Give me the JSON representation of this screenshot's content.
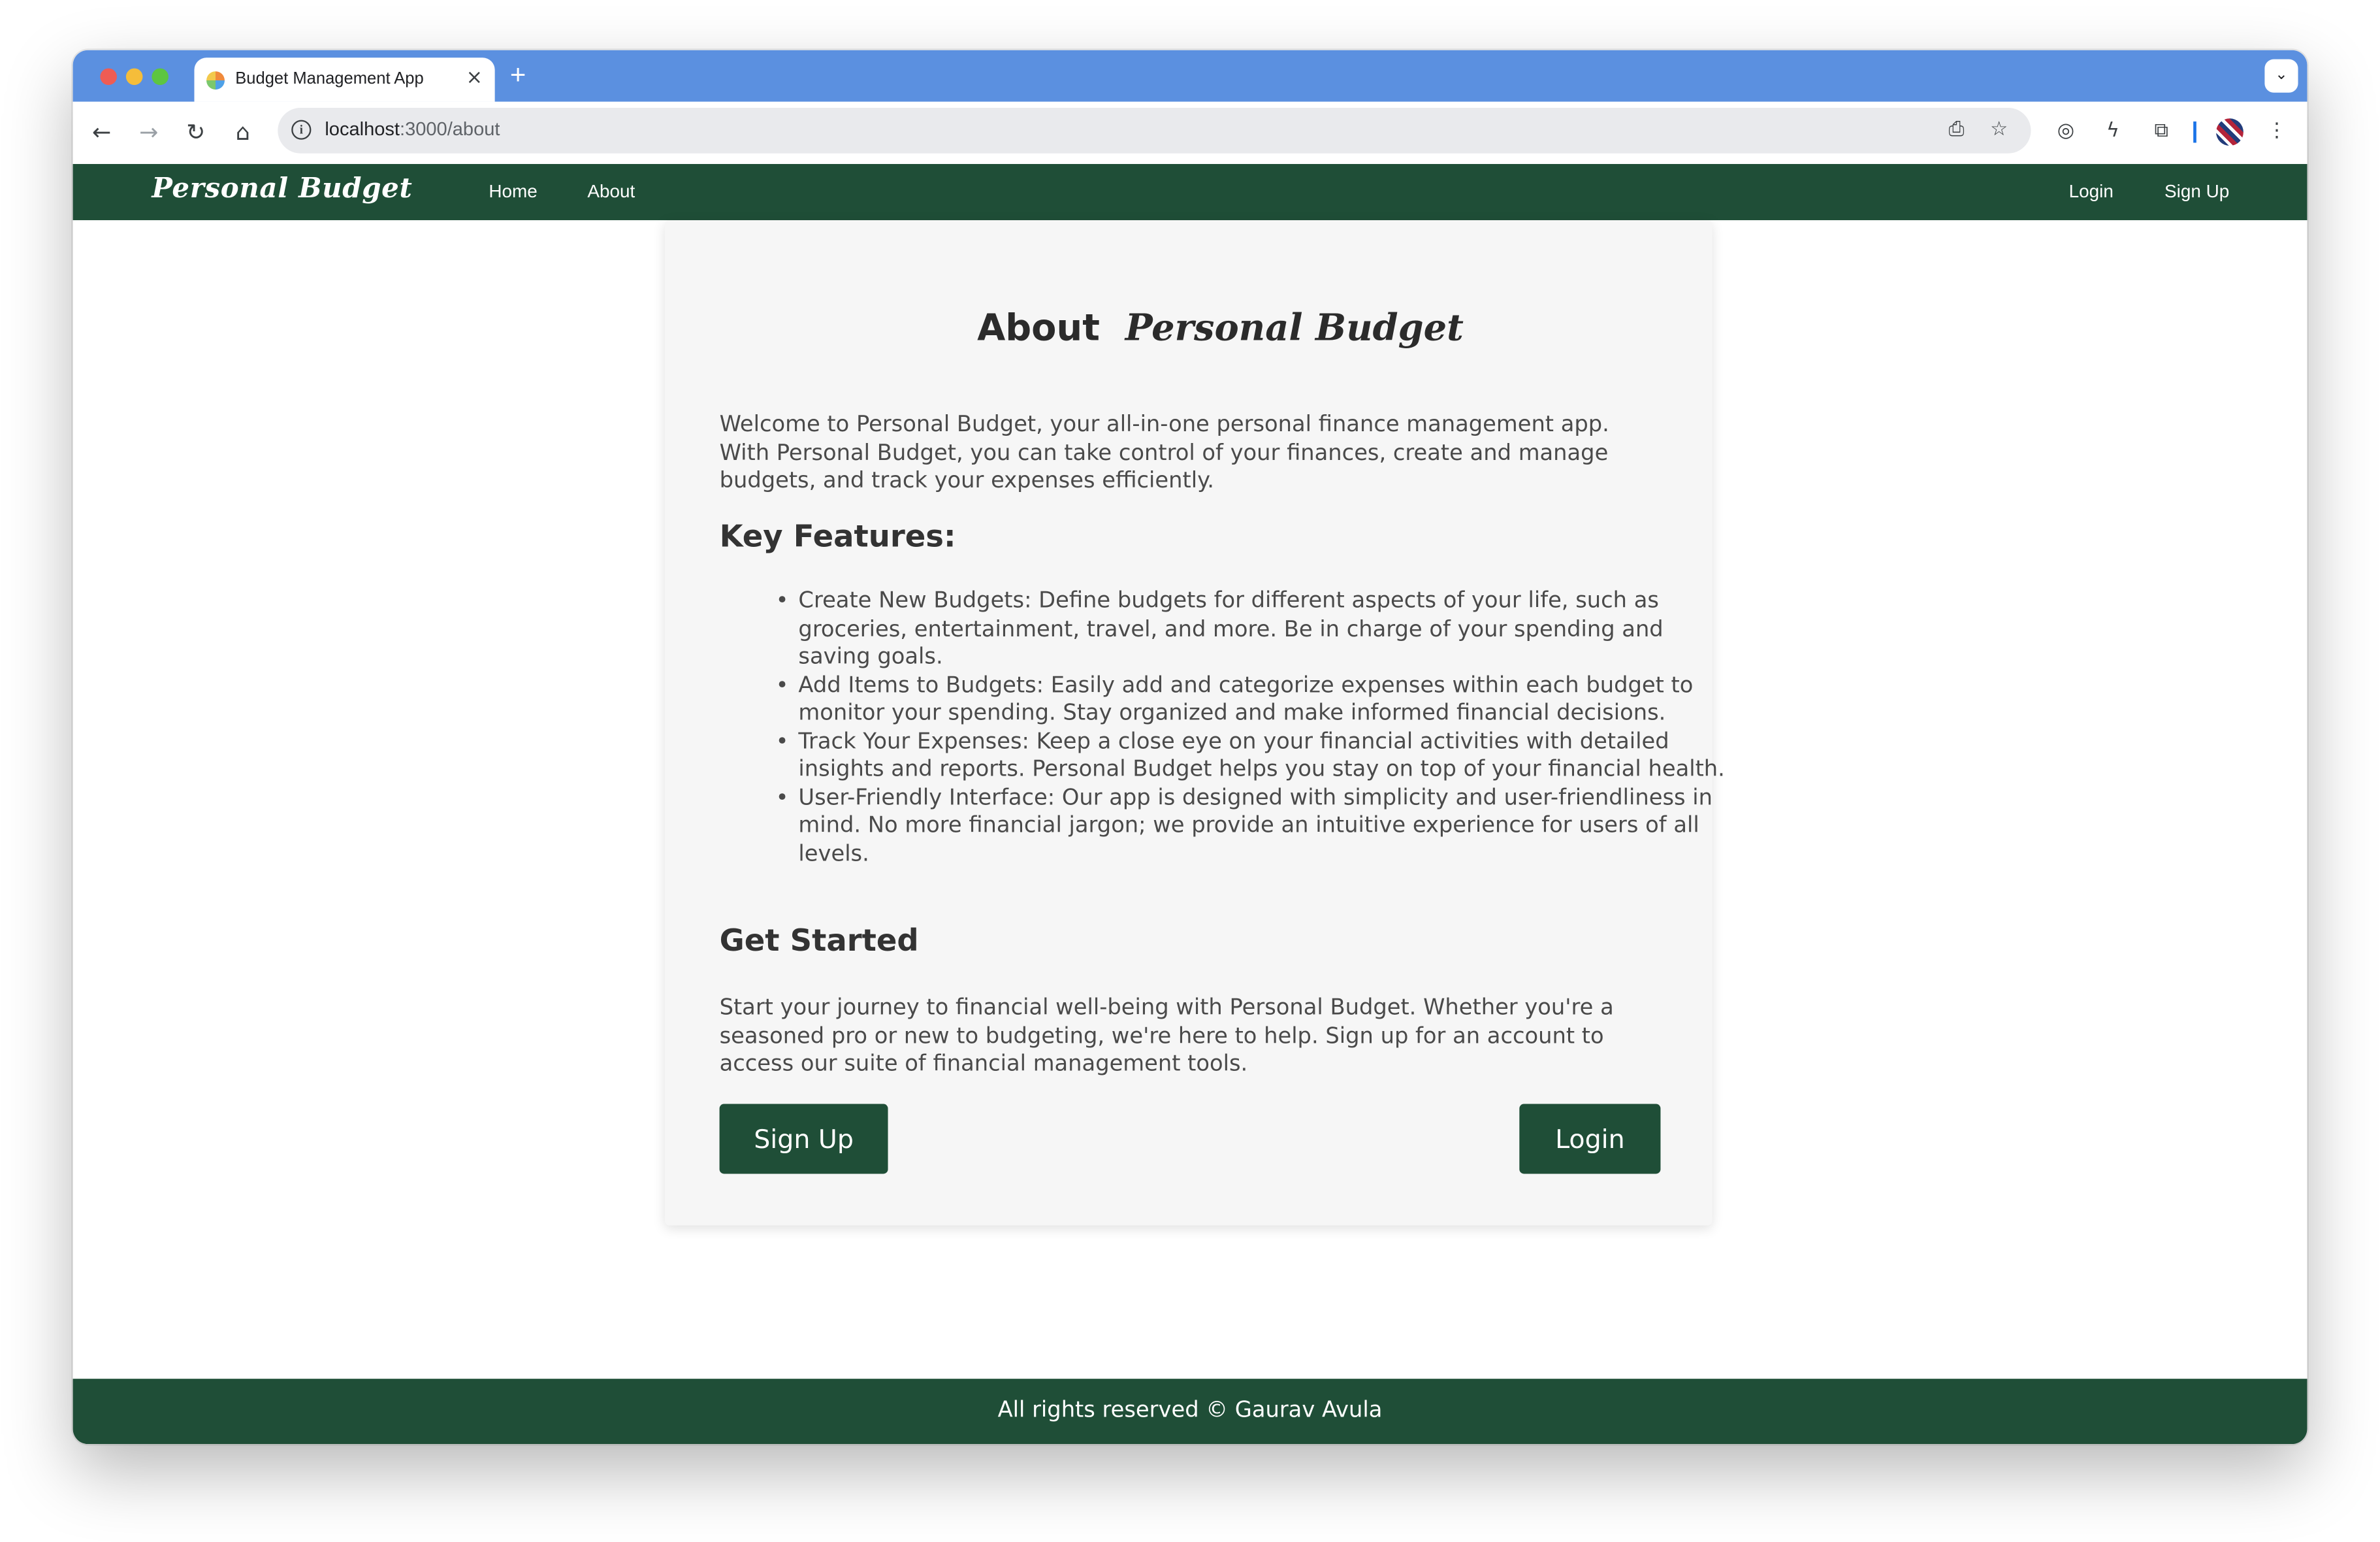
{
  "browser": {
    "tab_title": "Budget Management App",
    "tab_close": "×",
    "new_tab": "+",
    "tab_search": "⌄",
    "url_host": "localhost",
    "url_path": ":3000/about"
  },
  "navbar": {
    "brand": "Personal Budget",
    "links": [
      "Home",
      "About"
    ],
    "auth_links": [
      "Login",
      "Sign Up"
    ]
  },
  "about": {
    "title_prefix": "About",
    "title_brand": "Personal Budget",
    "intro": "Welcome to Personal Budget, your all-in-one personal finance management app. With Personal Budget, you can take control of your finances, create and manage budgets, and track your expenses efficiently.",
    "features_heading": "Key Features:",
    "features": [
      "Create New Budgets: Define budgets for different aspects of your life, such as groceries, entertainment, travel, and more. Be in charge of your spending and saving goals.",
      "Add Items to Budgets: Easily add and categorize expenses within each budget to monitor your spending. Stay organized and make informed financial decisions.",
      "Track Your Expenses: Keep a close eye on your financial activities with detailed insights and reports. Personal Budget helps you stay on top of your financial health.",
      "User-Friendly Interface: Our app is designed with simplicity and user-friendliness in mind. No more financial jargon; we provide an intuitive experience for users of all levels."
    ],
    "get_started_heading": "Get Started",
    "get_started_text": "Start your journey to financial well-being with Personal Budget. Whether you're a seasoned pro or new to budgeting, we're here to help. Sign up for an account to access our suite of financial management tools.",
    "signup_button": "Sign Up",
    "login_button": "Login"
  },
  "footer": {
    "text": "All rights reserved © Gaurav Avula"
  },
  "colors": {
    "brand_green": "#1f4e37",
    "chrome_blue": "#5b90e0",
    "card_bg": "#f6f6f6"
  }
}
